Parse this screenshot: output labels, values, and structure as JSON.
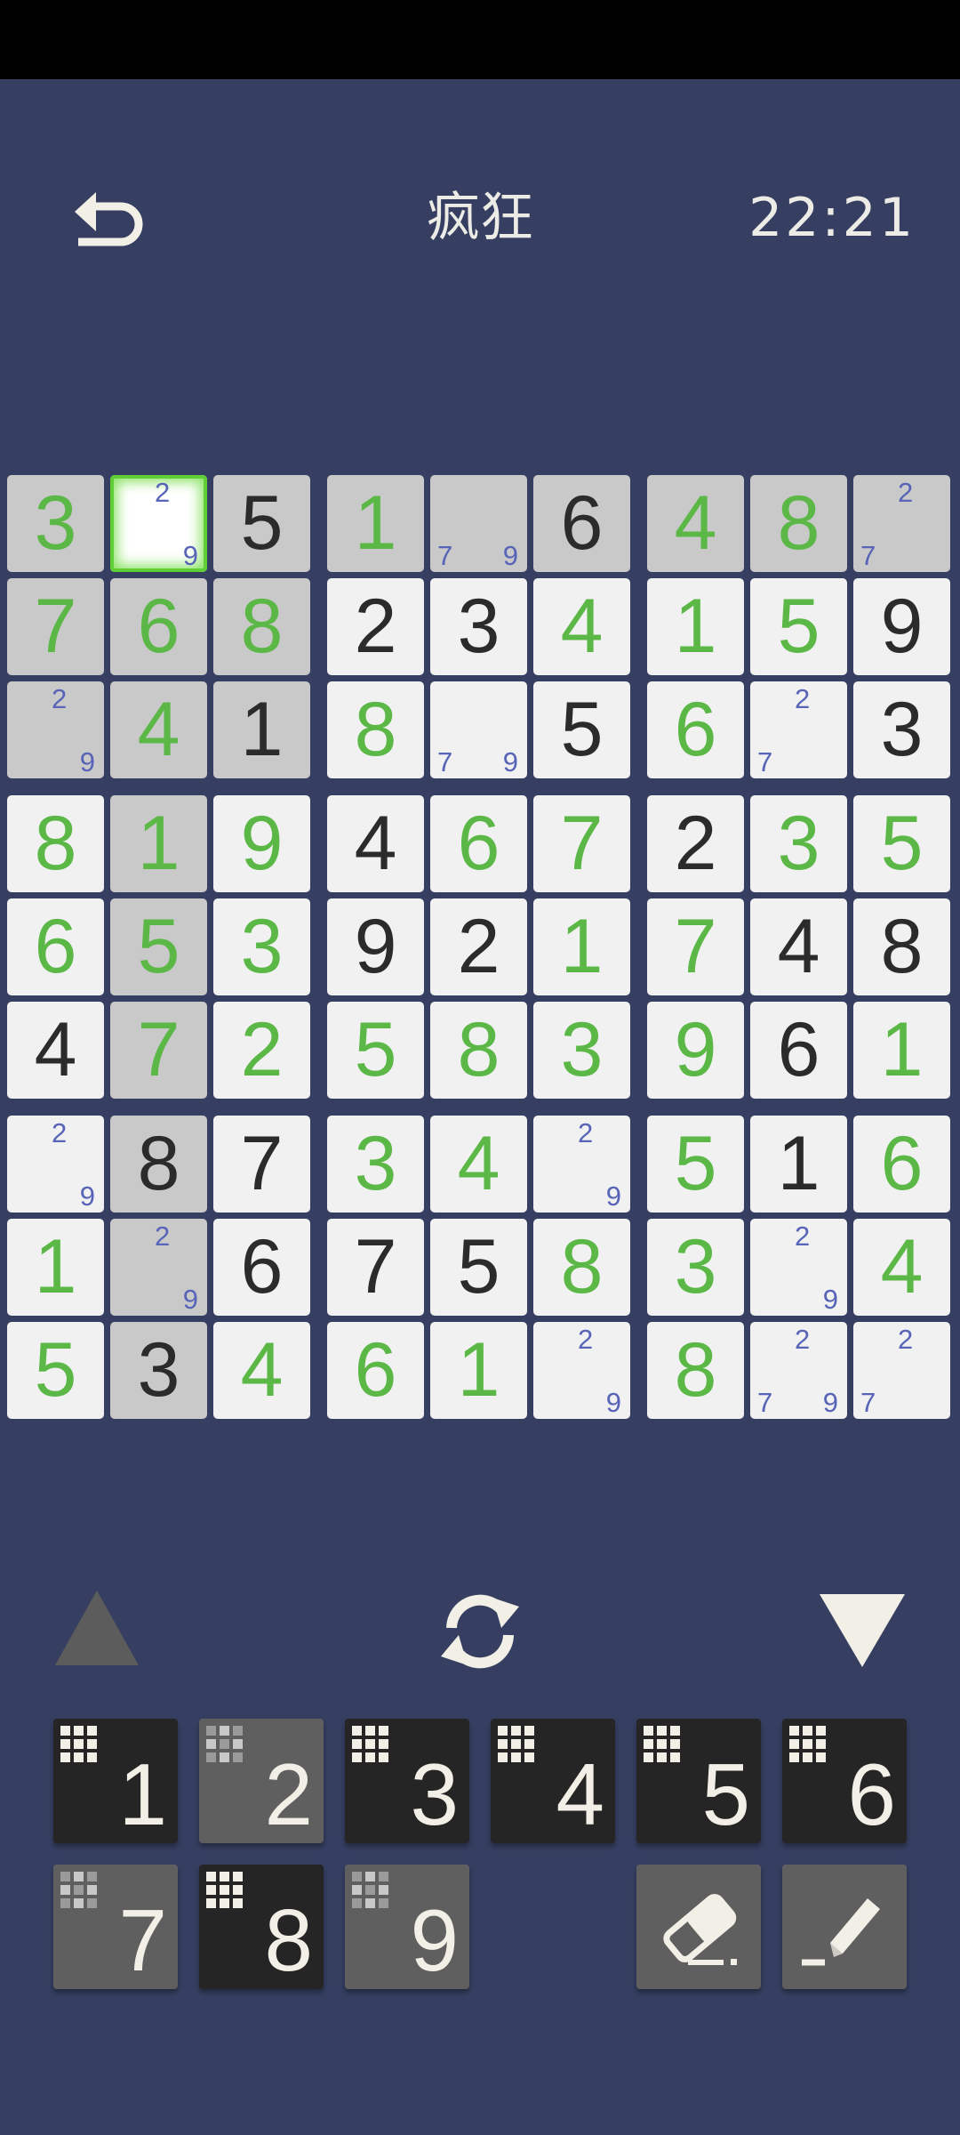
{
  "header": {
    "title": "疯狂",
    "timer": "22:21"
  },
  "board": {
    "rows": [
      [
        {
          "v": "3",
          "c": "g"
        },
        {
          "v": "",
          "notes": [
            "2",
            "9"
          ]
        },
        {
          "v": "5",
          "c": "k"
        },
        {
          "v": "1",
          "c": "g"
        },
        {
          "v": "",
          "notes": [
            "7",
            "9"
          ]
        },
        {
          "v": "6",
          "c": "k"
        },
        {
          "v": "4",
          "c": "g"
        },
        {
          "v": "8",
          "c": "g"
        },
        {
          "v": "",
          "notes": [
            "2",
            "7"
          ]
        }
      ],
      [
        {
          "v": "7",
          "c": "g"
        },
        {
          "v": "6",
          "c": "g"
        },
        {
          "v": "8",
          "c": "g"
        },
        {
          "v": "2",
          "c": "k"
        },
        {
          "v": "3",
          "c": "k"
        },
        {
          "v": "4",
          "c": "g"
        },
        {
          "v": "1",
          "c": "g"
        },
        {
          "v": "5",
          "c": "g"
        },
        {
          "v": "9",
          "c": "k"
        }
      ],
      [
        {
          "v": "",
          "notes": [
            "2",
            "9"
          ]
        },
        {
          "v": "4",
          "c": "g"
        },
        {
          "v": "1",
          "c": "k"
        },
        {
          "v": "8",
          "c": "g"
        },
        {
          "v": "",
          "notes": [
            "7",
            "9"
          ]
        },
        {
          "v": "5",
          "c": "k"
        },
        {
          "v": "6",
          "c": "g"
        },
        {
          "v": "",
          "notes": [
            "2",
            "7"
          ]
        },
        {
          "v": "3",
          "c": "k"
        }
      ],
      [
        {
          "v": "8",
          "c": "g"
        },
        {
          "v": "1",
          "c": "g"
        },
        {
          "v": "9",
          "c": "g"
        },
        {
          "v": "4",
          "c": "k"
        },
        {
          "v": "6",
          "c": "g"
        },
        {
          "v": "7",
          "c": "g"
        },
        {
          "v": "2",
          "c": "k"
        },
        {
          "v": "3",
          "c": "g"
        },
        {
          "v": "5",
          "c": "g"
        }
      ],
      [
        {
          "v": "6",
          "c": "g"
        },
        {
          "v": "5",
          "c": "g"
        },
        {
          "v": "3",
          "c": "g"
        },
        {
          "v": "9",
          "c": "k"
        },
        {
          "v": "2",
          "c": "k"
        },
        {
          "v": "1",
          "c": "g"
        },
        {
          "v": "7",
          "c": "g"
        },
        {
          "v": "4",
          "c": "k"
        },
        {
          "v": "8",
          "c": "k"
        }
      ],
      [
        {
          "v": "4",
          "c": "k"
        },
        {
          "v": "7",
          "c": "g"
        },
        {
          "v": "2",
          "c": "g"
        },
        {
          "v": "5",
          "c": "g"
        },
        {
          "v": "8",
          "c": "g"
        },
        {
          "v": "3",
          "c": "g"
        },
        {
          "v": "9",
          "c": "g"
        },
        {
          "v": "6",
          "c": "k"
        },
        {
          "v": "1",
          "c": "g"
        }
      ],
      [
        {
          "v": "",
          "notes": [
            "2",
            "9"
          ]
        },
        {
          "v": "8",
          "c": "k"
        },
        {
          "v": "7",
          "c": "k"
        },
        {
          "v": "3",
          "c": "g"
        },
        {
          "v": "4",
          "c": "g"
        },
        {
          "v": "",
          "notes": [
            "2",
            "9"
          ]
        },
        {
          "v": "5",
          "c": "g"
        },
        {
          "v": "1",
          "c": "k"
        },
        {
          "v": "6",
          "c": "g"
        }
      ],
      [
        {
          "v": "1",
          "c": "g"
        },
        {
          "v": "",
          "notes": [
            "2",
            "9"
          ]
        },
        {
          "v": "6",
          "c": "k"
        },
        {
          "v": "7",
          "c": "k"
        },
        {
          "v": "5",
          "c": "k"
        },
        {
          "v": "8",
          "c": "g"
        },
        {
          "v": "3",
          "c": "g"
        },
        {
          "v": "",
          "notes": [
            "2",
            "9"
          ]
        },
        {
          "v": "4",
          "c": "g"
        }
      ],
      [
        {
          "v": "5",
          "c": "g"
        },
        {
          "v": "3",
          "c": "k"
        },
        {
          "v": "4",
          "c": "g"
        },
        {
          "v": "6",
          "c": "g"
        },
        {
          "v": "1",
          "c": "g"
        },
        {
          "v": "",
          "notes": [
            "2",
            "9"
          ]
        },
        {
          "v": "8",
          "c": "g"
        },
        {
          "v": "",
          "notes": [
            "2",
            "7",
            "9"
          ]
        },
        {
          "v": "",
          "notes": [
            "2",
            "7"
          ]
        }
      ]
    ],
    "shaded": [
      [
        0,
        0
      ],
      [
        0,
        2
      ],
      [
        0,
        3
      ],
      [
        0,
        4
      ],
      [
        0,
        5
      ],
      [
        0,
        6
      ],
      [
        0,
        7
      ],
      [
        0,
        8
      ],
      [
        1,
        0
      ],
      [
        1,
        1
      ],
      [
        1,
        2
      ],
      [
        2,
        0
      ],
      [
        2,
        1
      ],
      [
        2,
        2
      ],
      [
        3,
        1
      ],
      [
        4,
        1
      ],
      [
        5,
        1
      ],
      [
        6,
        1
      ],
      [
        7,
        1
      ],
      [
        8,
        1
      ]
    ],
    "selected": [
      0,
      1
    ]
  },
  "controls": {
    "prev_icon": "triangle-up-icon",
    "refresh_icon": "refresh-icon",
    "next_icon": "triangle-down-icon"
  },
  "keypad": [
    {
      "digit": "1",
      "style": "dark"
    },
    {
      "digit": "2",
      "style": "grey"
    },
    {
      "digit": "3",
      "style": "dark"
    },
    {
      "digit": "4",
      "style": "dark"
    },
    {
      "digit": "5",
      "style": "dark"
    },
    {
      "digit": "6",
      "style": "dark"
    },
    {
      "digit": "7",
      "style": "grey"
    },
    {
      "digit": "8",
      "style": "dark"
    },
    {
      "digit": "9",
      "style": "grey"
    }
  ],
  "tools": [
    {
      "name": "eraser",
      "icon": "eraser-icon"
    },
    {
      "name": "pencil",
      "icon": "pencil-icon"
    }
  ],
  "colors": {
    "background": "#363f61",
    "given_digit": "#2b2b2b",
    "filled_digit": "#5bb847",
    "note": "#5764b8",
    "highlight": "#c9c9c9",
    "selection": "#5fcf35"
  }
}
